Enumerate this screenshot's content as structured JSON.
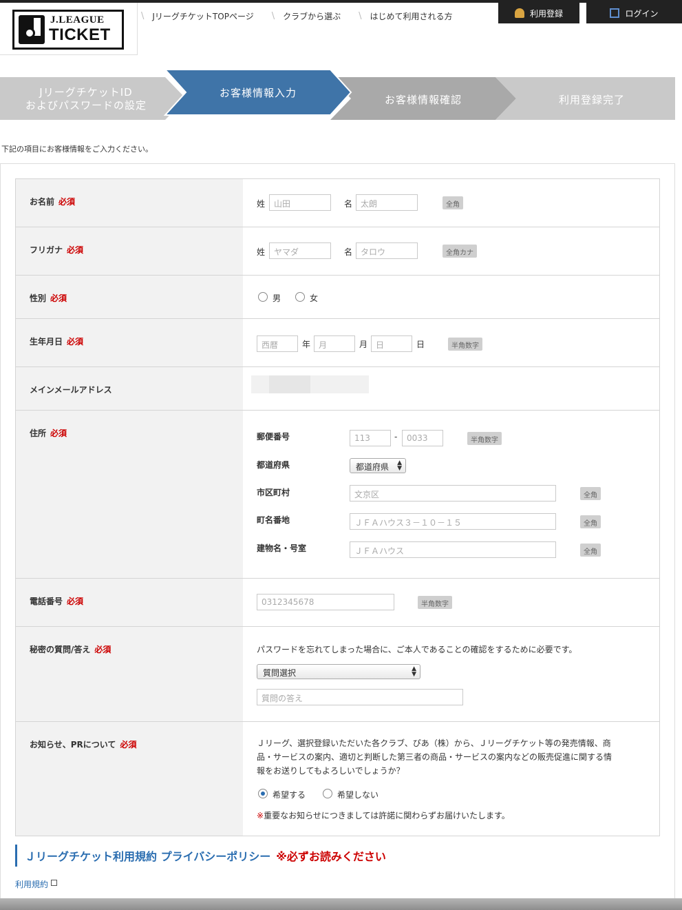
{
  "header": {
    "logo_line1": "J.LEAGUE",
    "logo_line2": "TICKET",
    "nav": [
      "JリーグチケットTOPページ",
      "クラブから選ぶ",
      "はじめて利用される方"
    ],
    "register_label": "利用登録",
    "login_label": "ログイン"
  },
  "steps": [
    {
      "label_line1": "JリーグチケットID",
      "label_line2": "およびパスワードの設定",
      "state": "done"
    },
    {
      "label_line1": "お客様情報入力",
      "label_line2": "",
      "state": "active"
    },
    {
      "label_line1": "お客様情報確認",
      "label_line2": "",
      "state": "todo"
    },
    {
      "label_line1": "利用登録完了",
      "label_line2": "",
      "state": "todo"
    }
  ],
  "lead": "下記の項目にお客様情報をご入力ください。",
  "required_mark": "必須",
  "form": {
    "name": {
      "label": "お名前",
      "sei": "姓",
      "mei": "名",
      "sei_placeholder": "山田",
      "mei_placeholder": "太朗",
      "tag": "全角"
    },
    "kana": {
      "label": "フリガナ",
      "sei": "姓",
      "mei": "名",
      "sei_placeholder": "ヤマダ",
      "mei_placeholder": "タロウ",
      "tag": "全角カナ"
    },
    "gender": {
      "label": "性別",
      "male": "男",
      "female": "女"
    },
    "birth": {
      "label": "生年月日",
      "year_placeholder": "西暦",
      "year": "年",
      "month_placeholder": "月",
      "month": "月",
      "day_placeholder": "日",
      "day": "日",
      "tag": "半角数字"
    },
    "email": {
      "label": "メインメールアドレス"
    },
    "address": {
      "label": "住所",
      "zip_label": "郵便番号",
      "zip1": "113",
      "zip_dash": "-",
      "zip2": "0033",
      "zip_tag": "半角数字",
      "pref_label": "都道府県",
      "pref_value": "都道府県",
      "city_label": "市区町村",
      "city_placeholder": "文京区",
      "city_tag": "全角",
      "street_label": "町名番地",
      "street_placeholder": "ＪＦＡハウス３－１０－１５",
      "street_tag": "全角",
      "bldg_label": "建物名・号室",
      "bldg_placeholder": "ＪＦＡハウス",
      "bldg_tag": "全角"
    },
    "phone": {
      "label": "電話番号",
      "placeholder": "0312345678",
      "tag": "半角数字"
    },
    "secret": {
      "label": "秘密の質問/答え",
      "note": "パスワードを忘れてしまった場合に、ご本人であることの確認をするために必要です。",
      "select_value": "質問選択",
      "answer_placeholder": "質問の答え"
    },
    "pr": {
      "label": "お知らせ、PRについて",
      "line1": "Ｊリーグ、選択登録いただいた各クラブ、ぴあ（株）から、Ｊリーグチケット等の発売情報、商",
      "line2": "品・サービスの案内、適切と判断した第三者の商品・サービスの案内などの販売促進に関する情",
      "line3": "報をお送りしてもよろしいでしょうか？",
      "opt_yes": "希望する",
      "opt_no": "希望しない",
      "notice": "※重要なお知らせにつきましては許諾に関わらずお届けいたします。"
    }
  },
  "terms": {
    "heading": "Ｊリーグチケット利用規約 プライバシーポリシー",
    "must_read": "※必ずお読みください",
    "link": "利用規約"
  },
  "colors": {
    "active_step": "#3f74a8",
    "done_step": "#c9c9c9",
    "todo_step": "#a9a9a9",
    "required": "#cc0000",
    "link": "#2a6db0"
  }
}
